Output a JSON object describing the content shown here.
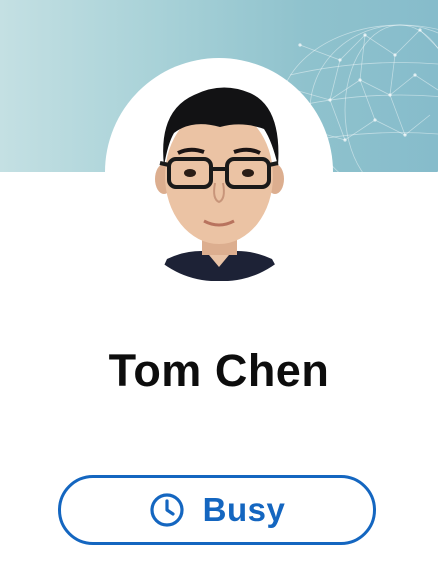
{
  "profile": {
    "name": "Tom Chen",
    "status": {
      "label": "Busy",
      "icon": "clock-icon"
    }
  },
  "colors": {
    "banner": "#a9d2d8",
    "accent": "#1466c0",
    "name_text": "#0d0d0d",
    "background": "#ffffff"
  }
}
